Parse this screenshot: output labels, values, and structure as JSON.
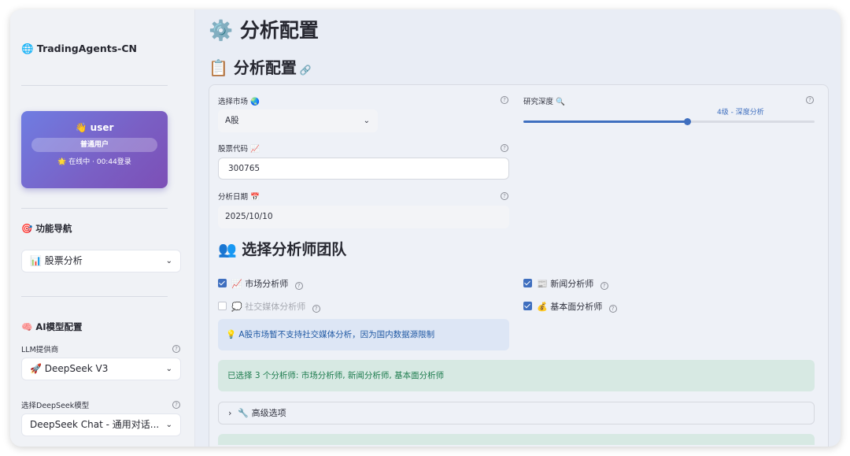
{
  "sidebar": {
    "brand": "🌐 TradingAgents-CN",
    "user": {
      "name": "👋 user",
      "role": "普通用户",
      "status": "🌟 在线中 · 00:44登录"
    },
    "nav_title": "🎯 功能导航",
    "nav_select": "📊 股票分析",
    "ai_title": "🧠 AI模型配置",
    "llm_label": "LLM提供商",
    "llm_value": "🚀 DeepSeek V3",
    "model_label": "选择DeepSeek模型",
    "model_value": "DeepSeek Chat - 通用对话..."
  },
  "main": {
    "page_title": "⚙️ 分析配置",
    "section_title": "📋 分析配置",
    "link_icon": "🔗",
    "market_label": "选择市场 🌏",
    "market_value": "A股",
    "code_label": "股票代码 📈",
    "code_value": "300765",
    "date_label": "分析日期 📅",
    "date_value": "2025/10/10",
    "depth_label": "研究深度 🔍",
    "depth_value": "4级 - 深度分析",
    "depth_level": 4,
    "depth_max": 5,
    "team_title": "👥 选择分析师团队",
    "analysts": [
      {
        "label": "📈 市场分析师",
        "checked": true,
        "disabled": false
      },
      {
        "label": "📰 新闻分析师",
        "checked": true,
        "disabled": false
      },
      {
        "label": "💭 社交媒体分析师",
        "checked": false,
        "disabled": true
      },
      {
        "label": "💰 基本面分析师",
        "checked": true,
        "disabled": false
      }
    ],
    "info_text": "💡 A股市场暂不支持社交媒体分析，因为国内数据源限制",
    "success_text": "已选择 3 个分析师: 市场分析师, 新闻分析师, 基本面分析师",
    "advanced_label": "🔧 高级选项"
  },
  "colors": {
    "accent": "#3f6fbf",
    "success_text": "#1c7b4d",
    "info_text": "#1f58a3"
  }
}
